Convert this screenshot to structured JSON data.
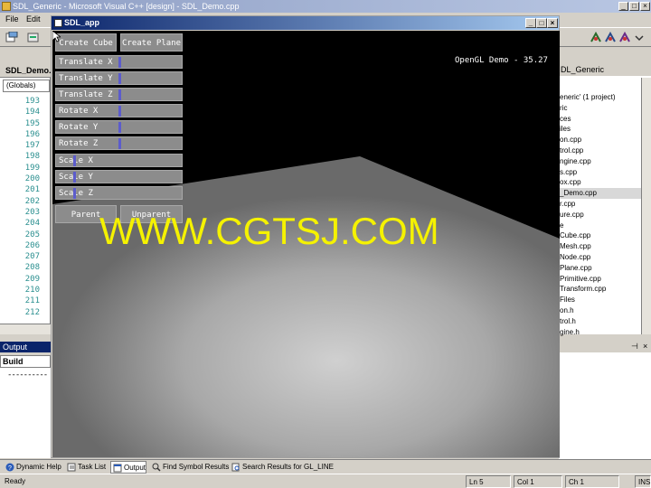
{
  "ide": {
    "title": "SDL_Generic - Microsoft Visual C++ [design] - SDL_Demo.cpp",
    "menu": [
      "File",
      "Edit"
    ],
    "editor_tab": "SDL_Demo.",
    "scope_combo": "(Globals)",
    "line_numbers": [
      "193",
      "194",
      "195",
      "196",
      "197",
      "198",
      "199",
      "200",
      "201",
      "202",
      "203",
      "204",
      "205",
      "206",
      "207",
      "208",
      "209",
      "210",
      "211",
      "212"
    ],
    "output_title": "Output",
    "output_build": "Build",
    "output_text": "----------"
  },
  "workspace": {
    "tab": "DL_Generic",
    "items": [
      "eneric' (1 project)",
      "ric",
      "ces",
      "iles",
      "on.cpp",
      "trol.cpp",
      "ngine.cpp",
      "s.cpp",
      "ox.cpp",
      "_Demo.cpp",
      "r.cpp",
      "ure.cpp",
      "e",
      "Cube.cpp",
      "Mesh.cpp",
      "Node.cpp",
      "Plane.cpp",
      "Primitive.cpp",
      "Transform.cpp",
      "Files",
      "on.h",
      "trol.h",
      "gine.h"
    ],
    "selected_index": 9
  },
  "sdl_app": {
    "title": "SDL_app",
    "fps_label": "OpenGL Demo - 35.27",
    "create_cube": "Create Cube",
    "create_plane": "Create Plane",
    "sliders": [
      {
        "label": "Translate X",
        "value": 0.5
      },
      {
        "label": "Translate Y",
        "value": 0.5
      },
      {
        "label": "Translate Z",
        "value": 0.5
      },
      {
        "label": "Rotate X",
        "value": 0.5
      },
      {
        "label": "Rotate Y",
        "value": 0.5
      },
      {
        "label": "Rotate Z",
        "value": 0.5
      },
      {
        "label": "Scale X",
        "value": 0.1
      },
      {
        "label": "Scale Y",
        "value": 0.1
      },
      {
        "label": "Scale Z",
        "value": 0.1
      }
    ],
    "parent": "Parent",
    "unparent": "Unparent"
  },
  "watermark": "WWW.CGTSJ.COM",
  "bottom_tabs": [
    "Dynamic Help",
    "Task List",
    "Output",
    "Find Symbol Results",
    "Search Results for GL_LINE"
  ],
  "active_bottom_tab": "Output",
  "status": {
    "ready": "Ready",
    "ln": "Ln 5",
    "col": "Col 1",
    "ch": "Ch 1",
    "ins": "INS"
  },
  "colors": {
    "slider_thumb": "#5c5ccc",
    "watermark": "#f5f200",
    "title_bar": "#0a246a"
  }
}
